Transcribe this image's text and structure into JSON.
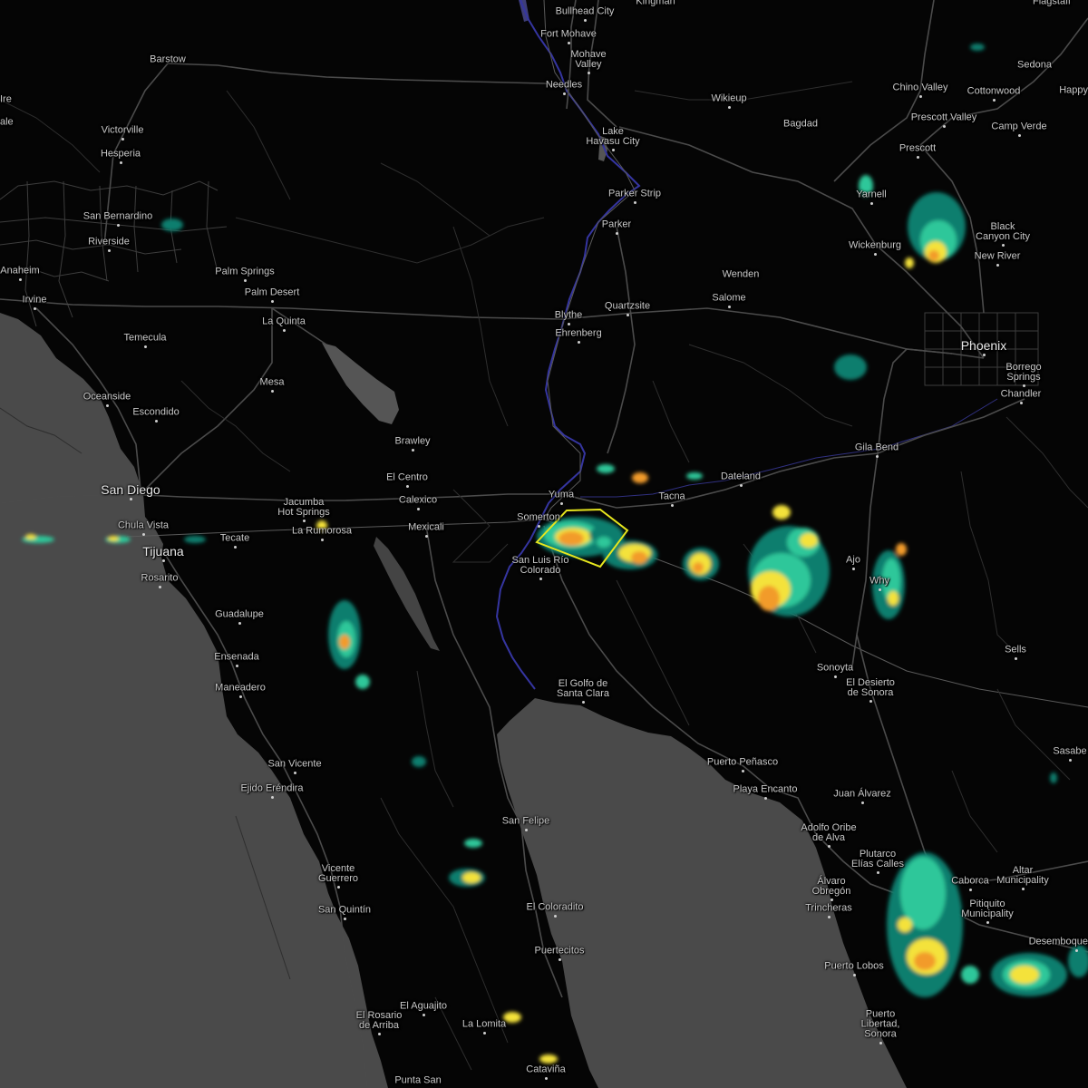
{
  "map": {
    "colors": {
      "land": "#050505",
      "water": "#4a4a4a",
      "lakes": "#555555",
      "roads": "#4b4b4b",
      "borders": "#5a5a5a",
      "rivers": "#3a3aa8",
      "labels": "#c8c8c8",
      "warning_polygon": "#e6e61e",
      "radar_scale": [
        "#0a7e6e",
        "#2fc79a",
        "#f4e23a",
        "#f29b2b",
        "#e23b2b"
      ]
    },
    "places": [
      {
        "name": "Bullhead City"
      },
      {
        "name": "Kingman"
      },
      {
        "name": "Flagstaff"
      },
      {
        "name": "Fort Mohave"
      },
      {
        "name": "Mohave\nValley"
      },
      {
        "name": "Needles"
      },
      {
        "name": "Barstow"
      },
      {
        "name": "Sedona"
      },
      {
        "name": "Happy"
      },
      {
        "name": "Chino Valley"
      },
      {
        "name": "Cottonwood"
      },
      {
        "name": "Wikieup"
      },
      {
        "name": "Prescott Valley"
      },
      {
        "name": "Victorville"
      },
      {
        "name": "Lake\nHavasu City"
      },
      {
        "name": "Bagdad"
      },
      {
        "name": "Camp Verde"
      },
      {
        "name": "Prescott"
      },
      {
        "name": "Hesperia"
      },
      {
        "name": "Yarnell"
      },
      {
        "name": "Parker Strip"
      },
      {
        "name": "San Bernardino"
      },
      {
        "name": "Parker"
      },
      {
        "name": "Black\nCanyon City"
      },
      {
        "name": "Riverside"
      },
      {
        "name": "Wickenburg"
      },
      {
        "name": "New River"
      },
      {
        "name": "Anaheim"
      },
      {
        "name": "Palm Springs"
      },
      {
        "name": "Wenden"
      },
      {
        "name": "Irvine"
      },
      {
        "name": "Palm Desert"
      },
      {
        "name": "Salome"
      },
      {
        "name": "Quartzsite"
      },
      {
        "name": "La Quinta"
      },
      {
        "name": "Blythe"
      },
      {
        "name": "Temecula"
      },
      {
        "name": "Ehrenberg"
      },
      {
        "name": "Phoenix",
        "big": true
      },
      {
        "name": "Mesa"
      },
      {
        "name": "Borrego\nSprings"
      },
      {
        "name": "Oceanside"
      },
      {
        "name": "Chandler"
      },
      {
        "name": "Escondido"
      },
      {
        "name": "Brawley"
      },
      {
        "name": "Gila Bend"
      },
      {
        "name": "El Centro"
      },
      {
        "name": "Dateland"
      },
      {
        "name": "San Diego",
        "big": true
      },
      {
        "name": "Yuma"
      },
      {
        "name": "Tacna"
      },
      {
        "name": "Jacumba\nHot Springs"
      },
      {
        "name": "Calexico"
      },
      {
        "name": "Somerton"
      },
      {
        "name": "Chula Vista"
      },
      {
        "name": "Mexicali"
      },
      {
        "name": "La Rumorosa"
      },
      {
        "name": "Tecate"
      },
      {
        "name": "Tijuana",
        "big": true
      },
      {
        "name": "San Luis Río\nColorado"
      },
      {
        "name": "Ajo"
      },
      {
        "name": "Rosarito"
      },
      {
        "name": "Why"
      },
      {
        "name": "Guadalupe"
      },
      {
        "name": "Sells"
      },
      {
        "name": "Ensenada"
      },
      {
        "name": "Sonoyta"
      },
      {
        "name": "El Desierto\nde Sonora"
      },
      {
        "name": "Maneadero"
      },
      {
        "name": "El Golfo de\nSanta Clara"
      },
      {
        "name": "Sasabe"
      },
      {
        "name": "Puerto Peñasco"
      },
      {
        "name": "San Vicente"
      },
      {
        "name": "Playa Encanto"
      },
      {
        "name": "Ejido Eréndira"
      },
      {
        "name": "Juan Álvarez"
      },
      {
        "name": "San Felipe"
      },
      {
        "name": "Adolfo Oribe\nde Alva"
      },
      {
        "name": "Plutarco\nElías Calles"
      },
      {
        "name": "Vicente\nGuerrero"
      },
      {
        "name": "Caborca"
      },
      {
        "name": "Altar\nMunicipality"
      },
      {
        "name": "Álvaro\nObregón"
      },
      {
        "name": "Pitiquito\nMunicipality"
      },
      {
        "name": "El Coloradito"
      },
      {
        "name": "San Quintín"
      },
      {
        "name": "Desemboque"
      },
      {
        "name": "Trincheras"
      },
      {
        "name": "Puertecitos"
      },
      {
        "name": "Puerto Lobos"
      },
      {
        "name": "El Aguajito"
      },
      {
        "name": "Puerto\nLibertad,\nSonora"
      },
      {
        "name": "El Rosario\nde Arriba"
      },
      {
        "name": "La Lomita"
      },
      {
        "name": "Cataviña"
      },
      {
        "name": "Punta San"
      },
      {
        "name": "Ire"
      },
      {
        "name": "ale"
      }
    ]
  }
}
